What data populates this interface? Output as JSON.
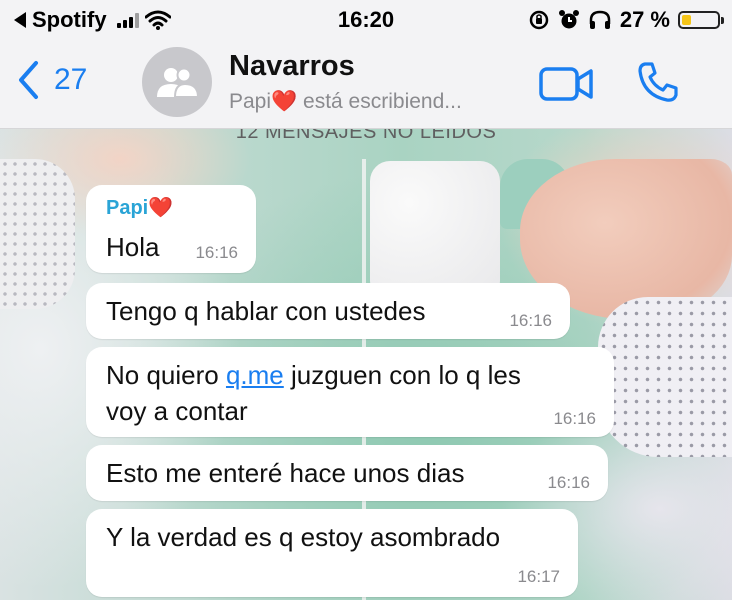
{
  "status_bar": {
    "carrier": "Spotify",
    "time": "16:20",
    "battery_percent": "27 %",
    "battery_level": 0.27,
    "colors": {
      "battery_fill": "#f5c518"
    }
  },
  "header": {
    "back_count": "27",
    "title": "Navarros",
    "subtitle_name": "Papi",
    "subtitle_heart": "❤️",
    "subtitle_status": " está escribiend...",
    "colors": {
      "accent": "#1a7ef0"
    }
  },
  "chat": {
    "unread_banner": "12 MENSAJES NO LEIDOS",
    "messages": [
      {
        "sender": "Papi",
        "sender_heart": "❤️",
        "text": "Hola",
        "time": "16:16"
      },
      {
        "text": "Tengo q hablar con ustedes",
        "time": "16:16"
      },
      {
        "text_before_link": "No quiero ",
        "link": "q.me",
        "text_after_link": " juzguen con lo q les",
        "text_line2": "voy a contar",
        "time": "16:16"
      },
      {
        "text": "Esto me enteré hace unos dias",
        "time": "16:16"
      },
      {
        "text": "Y la verdad es q estoy asombrado",
        "time": "16:17"
      }
    ],
    "colors": {
      "sender": "#2aa4d6",
      "link": "#1a7ef0",
      "bubble": "#ffffff"
    }
  }
}
